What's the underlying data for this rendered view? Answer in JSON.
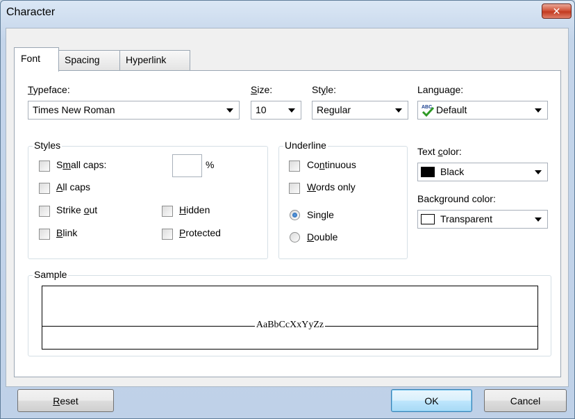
{
  "window": {
    "title": "Character",
    "close_icon": "close-icon"
  },
  "tabs": [
    {
      "label": "Font",
      "active": true
    },
    {
      "label": "Spacing",
      "active": false
    },
    {
      "label": "Hyperlink",
      "active": false
    }
  ],
  "typeface": {
    "label_pre": "",
    "label_u": "T",
    "label_post": "ypeface:",
    "value": "Times New Roman"
  },
  "size": {
    "label_pre": "",
    "label_u": "S",
    "label_post": "ize:",
    "value": "10"
  },
  "style": {
    "label_pre": "St",
    "label_u": "y",
    "label_post": "le:",
    "value": "Regular"
  },
  "language": {
    "label_pre": "Lan",
    "label_u": "g",
    "label_post": "uage:",
    "value": "Default",
    "icon": "spellcheck-icon"
  },
  "styles_group": {
    "title": "Styles",
    "small_caps": {
      "pre": "S",
      "u": "m",
      "post": "all caps:",
      "checked": false
    },
    "percent_value": "",
    "percent_sign": "%",
    "all_caps": {
      "pre": "",
      "u": "A",
      "post": "ll caps",
      "checked": false
    },
    "strike_out": {
      "pre": "Strike ",
      "u": "o",
      "post": "ut",
      "checked": false
    },
    "hidden": {
      "pre": "",
      "u": "H",
      "post": "idden",
      "checked": false
    },
    "blink": {
      "pre": "",
      "u": "B",
      "post": "link",
      "checked": false
    },
    "protected": {
      "pre": "",
      "u": "P",
      "post": "rotected",
      "checked": false
    }
  },
  "underline_group": {
    "title": "Underline",
    "continuous": {
      "pre": "Co",
      "u": "n",
      "post": "tinuous",
      "checked": false
    },
    "words_only": {
      "pre": "",
      "u": "W",
      "post": "ords only",
      "checked": false
    },
    "single": {
      "label": "Single",
      "selected": true
    },
    "double": {
      "pre": "",
      "u": "D",
      "post": "ouble",
      "selected": false
    }
  },
  "text_color": {
    "label_pre": "Text ",
    "label_u": "c",
    "label_post": "olor:",
    "value": "Black",
    "swatch": "#000000"
  },
  "background_color": {
    "label": "Background color:",
    "value": "Transparent",
    "swatch": "#ffffff"
  },
  "sample": {
    "title": "Sample",
    "text": "AaBbCcXxYyZz"
  },
  "buttons": {
    "reset": {
      "u": "R",
      "post": "eset"
    },
    "ok": "OK",
    "cancel": "Cancel"
  },
  "colors": {
    "accent": "#3c7fb1",
    "close": "#c23a20"
  }
}
